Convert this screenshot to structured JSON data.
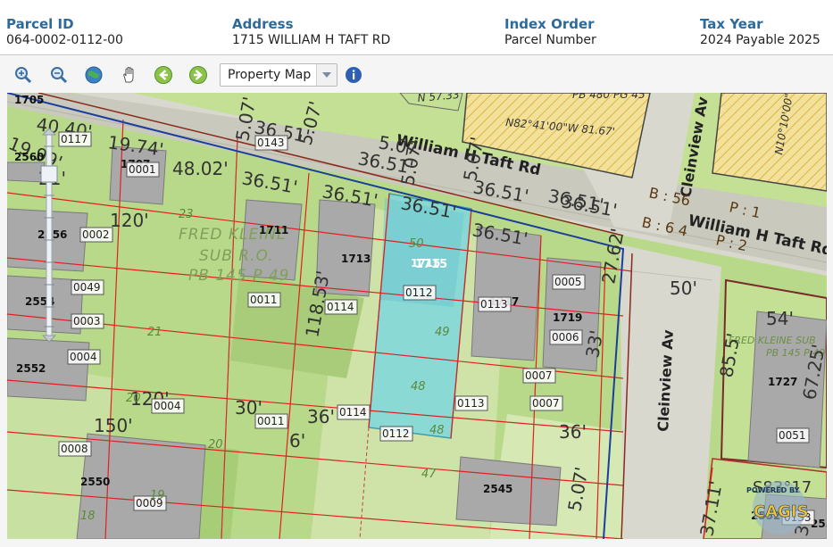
{
  "header": {
    "parcel_id": {
      "label": "Parcel ID",
      "value": "064-0002-0112-00"
    },
    "address": {
      "label": "Address",
      "value": "1715 WILLIAM H TAFT RD"
    },
    "index_order": {
      "label": "Index Order",
      "value": "Parcel Number"
    },
    "tax_year": {
      "label": "Tax Year",
      "value": "2024 Payable 2025"
    }
  },
  "toolbar": {
    "buttons": [
      "zoom-in-icon",
      "zoom-out-icon",
      "globe-icon",
      "pan-hand-icon",
      "back-arrow-icon",
      "forward-arrow-icon"
    ],
    "map_select_value": "Property Map",
    "info_icon": "info-icon"
  },
  "map": {
    "streets": {
      "taft": "William H Taft Rd",
      "taft_right": "William H Taft Rd",
      "cleinview_top": "Cleinview Av",
      "cleinview": "Cleinview Av"
    },
    "subdivision": {
      "line1": "FRED KLEINE",
      "line2": "SUB R.O.",
      "line3": "PB 145 P 49"
    },
    "subdivision_right": {
      "line1": "FRED KLEINE SUB",
      "line2": "PB 145 P 49"
    },
    "book_page_top": "PB 480 PG 45",
    "bearing_top": "N82°41'00\"W 81.67'",
    "bearing_top_left": "N 57.33'",
    "bearing_right_top": "N10°10'00\"",
    "bearing_right_bottom": "S83°17",
    "book": {
      "b56": "B : 56",
      "p1": "P : 1",
      "b64": "B : 6 4",
      "p2": "P : 2"
    },
    "address_labels": [
      "1705",
      "2560",
      "1707",
      "1711",
      "1713",
      "1715",
      "1717",
      "1719",
      "2556",
      "2554",
      "2552",
      "2550",
      "2545",
      "1727",
      "2552",
      "2554"
    ],
    "parcel_labels": [
      "0117",
      "0001",
      "0143",
      "0002",
      "0049",
      "0003",
      "0004",
      "0011",
      "0114",
      "0112",
      "0113",
      "0005",
      "0006",
      "0007",
      "0007",
      "0004",
      "0011",
      "0114",
      "0112",
      "0113",
      "0008",
      "0009",
      "0051",
      "0133"
    ],
    "dimensions": [
      "40.40'",
      "19.99'",
      "21'",
      "19.74'",
      "48.02'",
      "36.51'",
      "36.51'",
      "5.07'",
      "5.07'",
      "36.51'",
      "36.51'",
      "5.07'",
      "36.51'",
      "5.07'",
      "36.51'",
      "5.07'",
      "36.51'",
      "36.51'",
      "36.51'",
      "27.62'",
      "33'",
      "120'",
      "118.53'",
      "50'",
      "54'",
      "85.5'",
      "67.25'",
      "120'",
      "150'",
      "30'",
      "36'",
      "6'",
      "36'",
      "37.11'",
      "31'",
      "5.07'"
    ],
    "lot_numbers": [
      "23",
      "21",
      "20",
      "20",
      "19",
      "18",
      "50",
      "49",
      "48",
      "48",
      "47",
      "1715"
    ],
    "watermark": {
      "powered_by": "POWERED BY",
      "brand": "CAGIS"
    }
  }
}
